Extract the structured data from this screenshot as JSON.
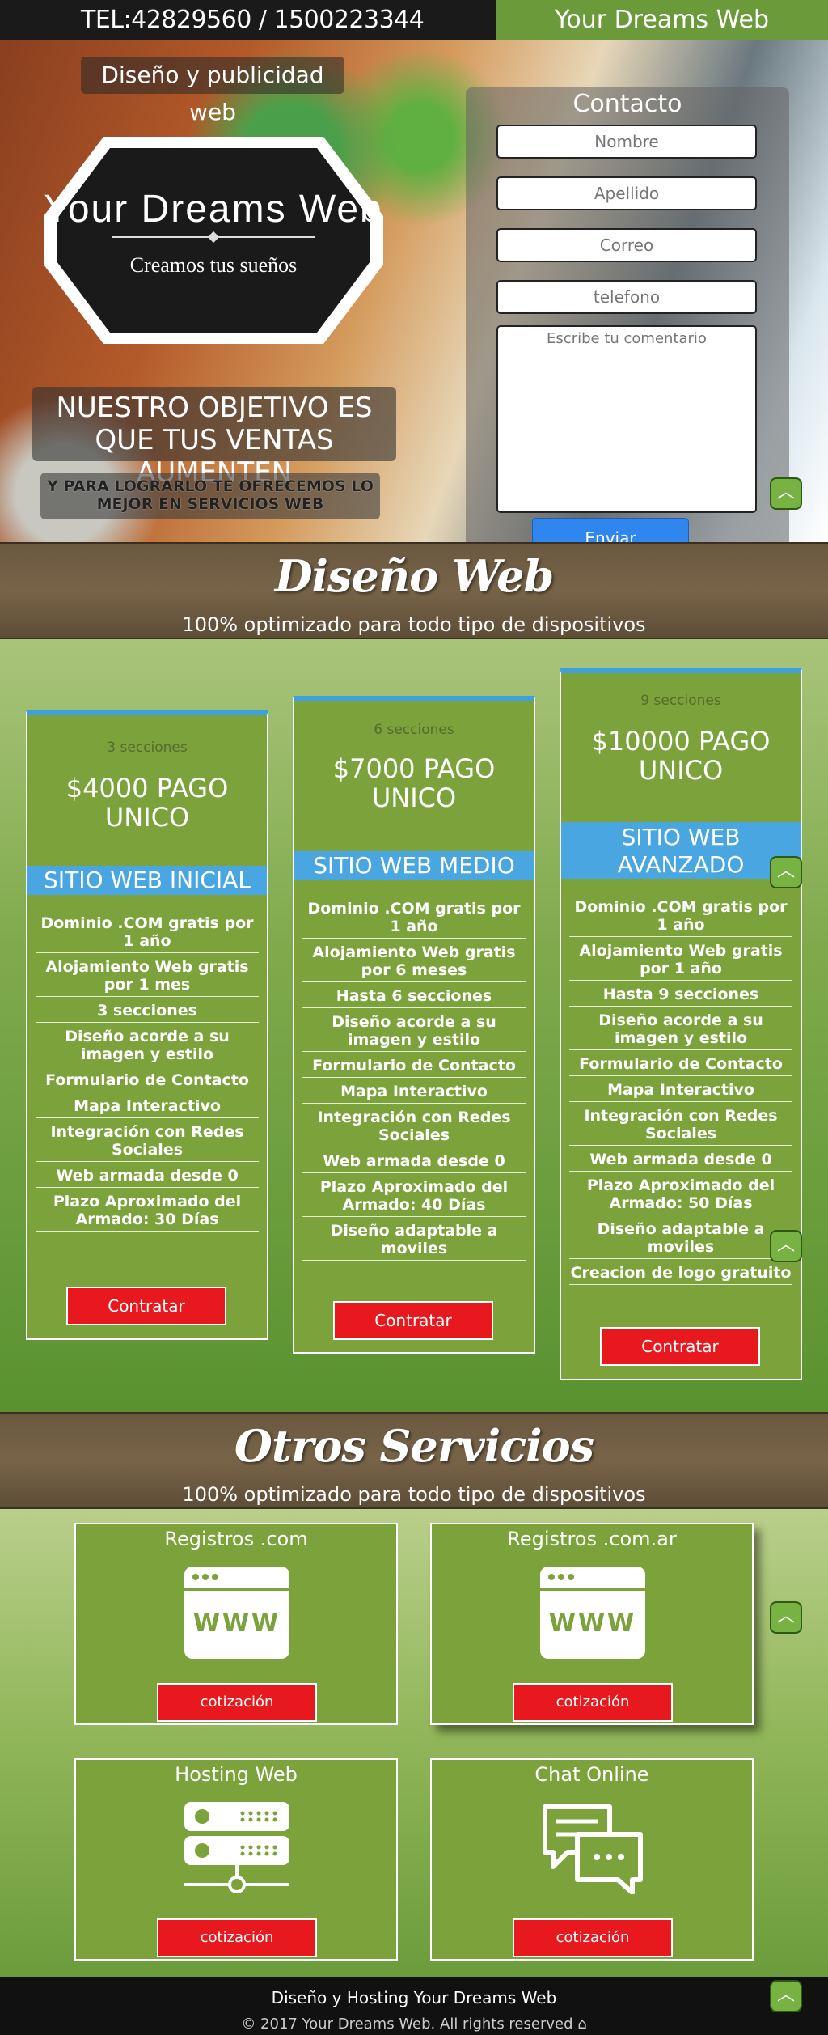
{
  "header": {
    "phone": "TEL:42829560 / 1500223344",
    "brand": "Your Dreams Web"
  },
  "hero": {
    "slogan": "Diseño y publicidad web",
    "logo_title": "Your Dreams Web",
    "logo_tagline": "Creamos tus sueños",
    "goal": "NUESTRO OBJETIVO ES QUE TUS VENTAS AUMENTEN",
    "sub": "Y PARA LOGRARLO TE OFRECEMOS LO MEJOR EN SERVICIOS WEB"
  },
  "contact": {
    "title": "Contacto",
    "name_placeholder": "Nombre",
    "lastname_placeholder": "Apellido",
    "email_placeholder": "Correo",
    "phone_placeholder": "telefono",
    "comment_placeholder": "Escribe tu comentario",
    "send_label": "Enviar"
  },
  "design": {
    "title": "Diseño Web",
    "subtitle": "100% optimizado para todo tipo de dispositivos"
  },
  "plans": [
    {
      "sections": "3 secciones",
      "price": "$4000 PAGO UNICO",
      "tier": "SITIO WEB INICIAL",
      "features": [
        "Dominio .COM gratis por 1 año",
        "Alojamiento Web gratis por 1 mes",
        "3 secciones",
        "Diseño acorde a su imagen y estilo",
        "Formulario de Contacto",
        "Mapa Interactivo",
        "Integración con Redes Sociales",
        "Web armada desde 0",
        "Plazo Aproximado del Armado: 30 Días"
      ],
      "button": "Contratar"
    },
    {
      "sections": "6 secciones",
      "price": "$7000 PAGO UNICO",
      "tier": "SITIO WEB MEDIO",
      "features": [
        "Dominio .COM gratis por 1 año",
        "Alojamiento Web gratis por 6 meses",
        "Hasta 6 secciones",
        "Diseño acorde a su imagen y estilo",
        "Formulario de Contacto",
        "Mapa Interactivo",
        "Integración con Redes Sociales",
        "Web armada desde 0",
        "Plazo Aproximado del Armado: 40 Días",
        "Diseño adaptable a moviles"
      ],
      "button": "Contratar"
    },
    {
      "sections": "9 secciones",
      "price": "$10000 PAGO UNICO",
      "tier": "SITIO WEB AVANZADO",
      "features": [
        "Dominio .COM gratis por 1 año",
        "Alojamiento Web gratis por 1 año",
        "Hasta 9 secciones",
        "Diseño acorde a su imagen y estilo",
        "Formulario de Contacto",
        "Mapa Interactivo",
        "Integración con Redes Sociales",
        "Web armada desde 0",
        "Plazo Aproximado del Armado: 50 Días",
        "Diseño adaptable a moviles",
        "Creacion de logo gratuito"
      ],
      "button": "Contratar"
    }
  ],
  "other": {
    "title": "Otros Servicios",
    "subtitle": "100% optimizado para todo tipo de dispositivos"
  },
  "services": [
    {
      "label": "Registros .com",
      "icon": "www-browser-icon",
      "button": "cotización"
    },
    {
      "label": "Registros .com.ar",
      "icon": "www-browser-icon",
      "button": "cotización"
    },
    {
      "label": "Hosting Web",
      "icon": "server-icon",
      "button": "cotización"
    },
    {
      "label": "Chat Online",
      "icon": "chat-bubbles-icon",
      "button": "cotización"
    }
  ],
  "footer": {
    "line1": "Diseño y Hosting Your Dreams Web",
    "line2": "© 2017 Your Dreams Web. All rights reserved ⌂"
  },
  "totop_icon": "chevron-up-icon",
  "colors": {
    "accent_green": "#7ca23c",
    "button_red": "#e8191e",
    "tier_blue": "#4aa6e0",
    "send_blue": "#2f86ef"
  }
}
